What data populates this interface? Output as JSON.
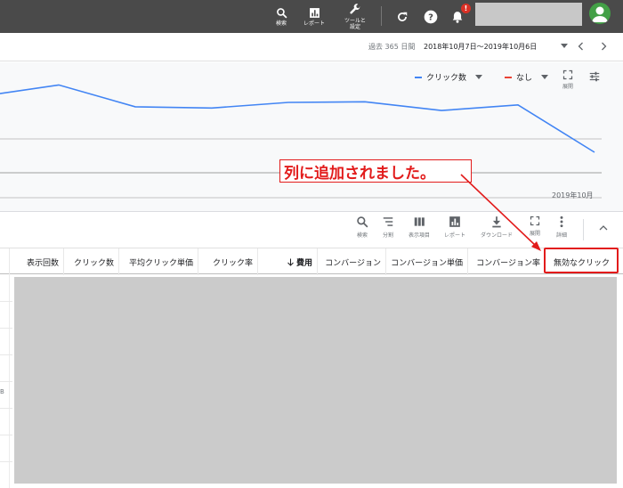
{
  "topbar": {
    "search_label": "検索",
    "report_label": "レポート",
    "tools_label_line1": "ツールと",
    "tools_label_line2": "設定",
    "notification_count": "!"
  },
  "date": {
    "period_label": "過去 365 日間",
    "range": "2018年10月7日～2019年10月6日"
  },
  "chart_controls": {
    "metric1": "クリック数",
    "metric1_color": "#4285f4",
    "metric2": "なし",
    "metric2_color": "#ea4335",
    "expand_label": "展開"
  },
  "chart_data": {
    "type": "line",
    "x_tick_label": "2019年10月",
    "series": [
      {
        "values": [
          0.6,
          0.78,
          0.43,
          0.41,
          0.5,
          0.51,
          0.37,
          0.46,
          -0.3
        ]
      }
    ],
    "ylim": [
      -1,
      1
    ],
    "grid": true
  },
  "annotation": {
    "text": "列に追加されました。",
    "color": "#e21b1b"
  },
  "toolbar": {
    "search": "検索",
    "segment": "分割",
    "columns": "表示項目",
    "report": "レポート",
    "download": "ダウンロード",
    "expand": "展開",
    "details": "詳細"
  },
  "table": {
    "columns": [
      "表示回数",
      "クリック数",
      "平均クリック単価",
      "クリック率",
      "費用",
      "コンバージョン",
      "コンバージョン単価",
      "コンバージョン率",
      "無効なクリック"
    ],
    "left_tick": "B"
  }
}
